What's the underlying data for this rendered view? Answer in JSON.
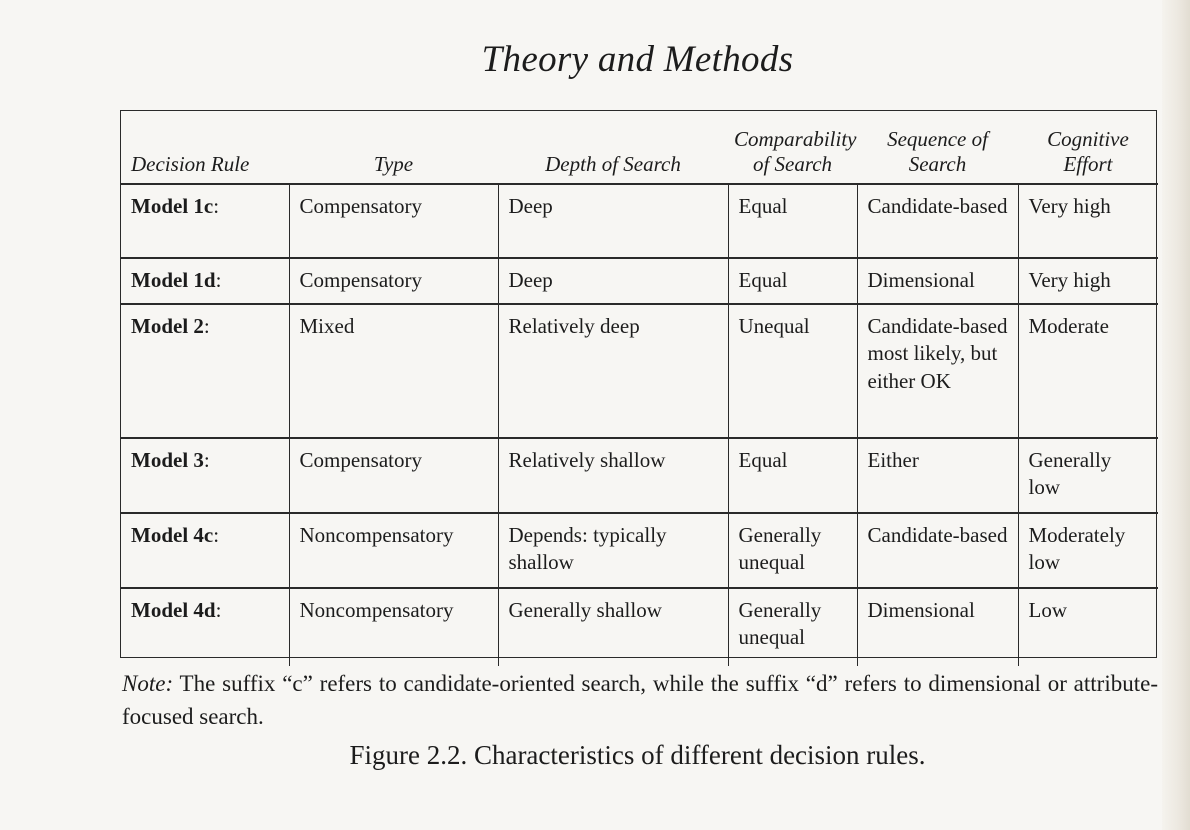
{
  "running_head": "Theory and Methods",
  "table": {
    "headers": [
      "Decision Rule",
      "Type",
      "Depth of Search",
      "Comparability of Search",
      "Sequence of Search",
      "Cognitive Effort"
    ],
    "rows": [
      {
        "rule": "Model 1c",
        "rule_suffix": ":",
        "type": "Compensatory",
        "depth": "Deep",
        "comparability": "Equal",
        "sequence": "Candidate-based",
        "effort": "Very high"
      },
      {
        "rule": "Model 1d",
        "rule_suffix": ":",
        "type": "Compensatory",
        "depth": "Deep",
        "comparability": "Equal",
        "sequence": "Dimensional",
        "effort": "Very high"
      },
      {
        "rule": "Model 2",
        "rule_suffix": ":",
        "type": "Mixed",
        "depth": "Relatively deep",
        "comparability": "Unequal",
        "sequence": "Candidate-based most likely, but either OK",
        "effort": "Moderate"
      },
      {
        "rule": "Model 3",
        "rule_suffix": ":",
        "type": "Compensatory",
        "depth": "Relatively shallow",
        "comparability": "Equal",
        "sequence": "Either",
        "effort": "Generally low"
      },
      {
        "rule": "Model 4c",
        "rule_suffix": ":",
        "type": "Noncompensatory",
        "depth": "Depends: typically shallow",
        "comparability": "Generally unequal",
        "sequence": "Candidate-based",
        "effort": "Moderately low"
      },
      {
        "rule": "Model 4d",
        "rule_suffix": ":",
        "type": "Noncompensatory",
        "depth": "Generally shallow",
        "comparability": "Generally unequal",
        "sequence": "Dimensional",
        "effort": "Low"
      }
    ]
  },
  "note": {
    "label": "Note:",
    "text": "The suffix “c” refers to candidate-oriented search, while the suffix “d” refers to dimensional or attribute-focused search."
  },
  "caption": "Figure 2.2. Characteristics of different decision rules."
}
